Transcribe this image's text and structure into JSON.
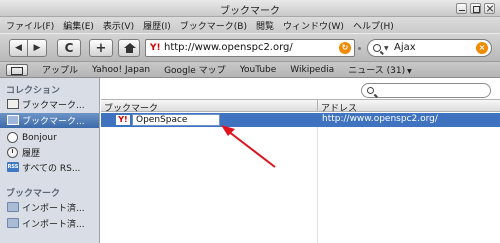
{
  "window": {
    "title": "ブックマーク"
  },
  "menu": [
    "ファイル(F)",
    "編集(E)",
    "表示(V)",
    "履歴(I)",
    "ブックマーク(B)",
    "閲覧",
    "ウィンドウ(W)",
    "ヘルプ(H)"
  ],
  "toolbar": {
    "back_icon": "◀",
    "forward_icon": "▶",
    "reload_icon": "C",
    "add_icon": "+",
    "url": "http://www.openspc2.org/",
    "url_favicon": "Y!",
    "search_value": "Ajax"
  },
  "bookmarks_bar": {
    "items": [
      "アップル",
      "Yahoo! Japan",
      "Google マップ",
      "YouTube",
      "Wikipedia",
      "ニュース (31)"
    ]
  },
  "sidebar": {
    "collections_header": "コレクション",
    "items": [
      "ブックマーク...",
      "ブックマーク...",
      "Bonjour",
      "履歴",
      "すべての RS..."
    ],
    "rss_badge": "RSS",
    "bookmarks_header": "ブックマーク",
    "folders": [
      "インポート済...",
      "インポート済..."
    ]
  },
  "table": {
    "columns": [
      "ブックマーク",
      "アドレス"
    ],
    "rows": [
      {
        "name": "OpenSpace",
        "address": "http://www.openspc2.org/",
        "favicon": "Y!"
      }
    ]
  },
  "colors": {
    "selection": "#3f73c0",
    "annotation_arrow": "#e0141e",
    "sidebar_bg": "#d8dde6"
  }
}
